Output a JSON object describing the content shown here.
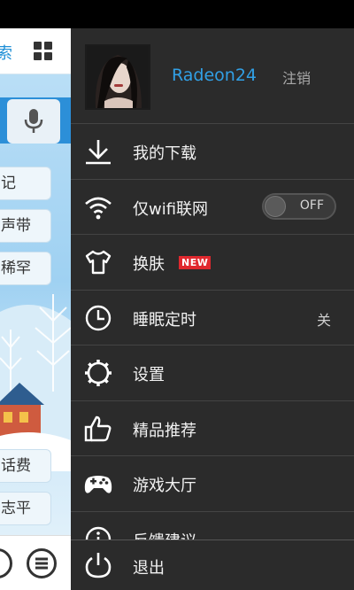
{
  "background_app": {
    "tab_partial": "索",
    "chips": [
      "记",
      "声带",
      "稀罕",
      "话费",
      "志平"
    ]
  },
  "drawer": {
    "username": "Radeon24",
    "logout_label": "注销",
    "items": [
      {
        "label": "我的下载",
        "icon": "download-icon"
      },
      {
        "label": "仅wifi联网",
        "icon": "wifi-icon",
        "toggle": "OFF"
      },
      {
        "label": "换肤",
        "icon": "tshirt-icon",
        "badge": "NEW"
      },
      {
        "label": "睡眠定时",
        "icon": "clock-icon",
        "value": "关"
      },
      {
        "label": "设置",
        "icon": "gear-icon"
      },
      {
        "label": "精品推荐",
        "icon": "thumbs-up-icon"
      },
      {
        "label": "游戏大厅",
        "icon": "gamepad-icon"
      },
      {
        "label": "反馈建议",
        "icon": "info-icon"
      }
    ],
    "exit_label": "退出",
    "exit_icon": "power-icon"
  },
  "colors": {
    "accent": "#31a0e6",
    "drawer_bg": "#2b2b2b",
    "badge": "#e0282e"
  }
}
